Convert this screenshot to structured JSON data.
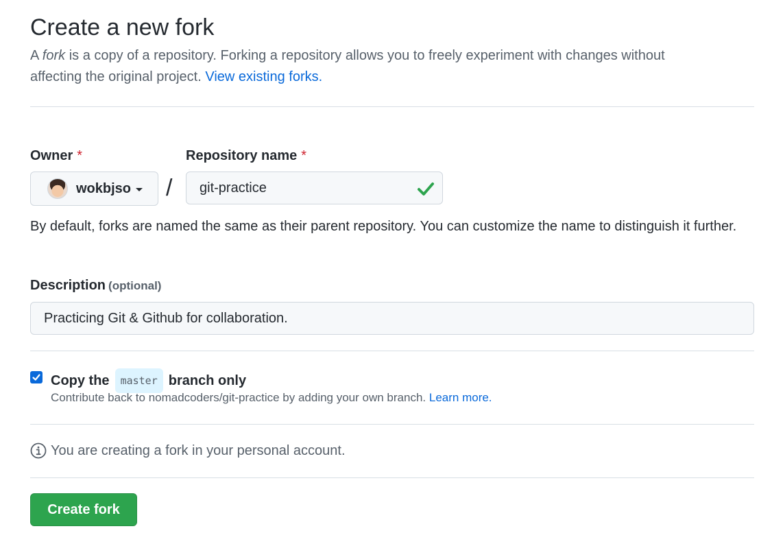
{
  "header": {
    "title": "Create a new fork",
    "subtitle_prefix": "A ",
    "subtitle_fork_word": "fork",
    "subtitle_rest": " is a copy of a repository. Forking a repository allows you to freely experiment with changes without affecting the original project. ",
    "view_forks_link": "View existing forks."
  },
  "form": {
    "owner_label": "Owner",
    "required_mark": "*",
    "owner_value": "wokbjso",
    "slash": "/",
    "repo_label": "Repository name",
    "repo_value": "git-practice",
    "repo_help": "By default, forks are named the same as their parent repository. You can customize the name to distinguish it further.",
    "description_label": "Description",
    "description_optional": "(optional)",
    "description_value": "Practicing Git & Github for collaboration.",
    "copy_prefix": "Copy the",
    "copy_branch": "master",
    "copy_suffix": "branch only",
    "copy_checked": true,
    "contrib_text": "Contribute back to nomadcoders/git-practice by adding your own branch. ",
    "learn_more_link": "Learn more.",
    "info_text": "You are creating a fork in your personal account.",
    "create_button": "Create fork"
  },
  "colors": {
    "accent_link": "#0969da",
    "primary_button": "#2da44e",
    "valid_check": "#2da44e",
    "required": "#cf222e"
  },
  "icons": [
    "owner-avatar",
    "caret-down-icon",
    "check-icon",
    "checkbox-check-icon",
    "info-icon"
  ]
}
